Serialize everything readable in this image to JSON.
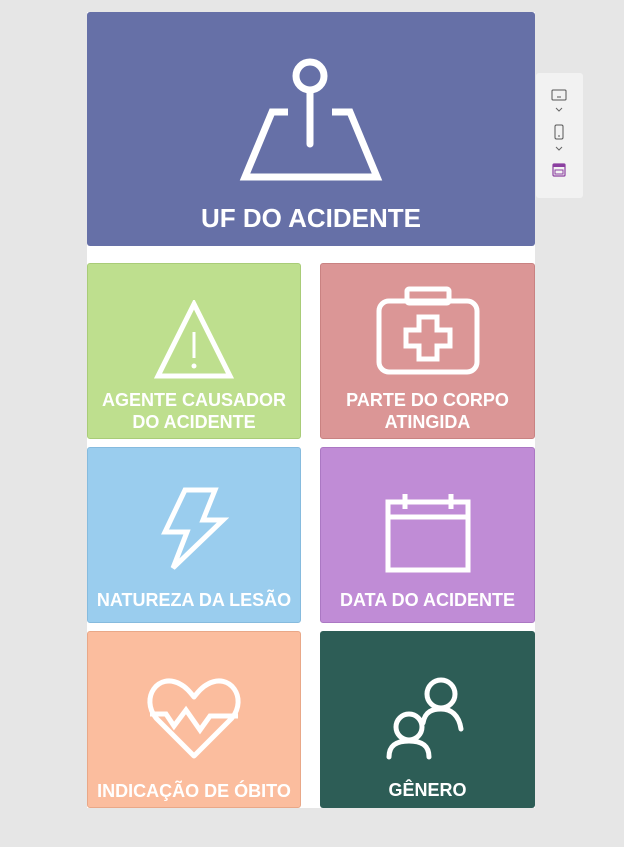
{
  "tiles": {
    "uf": {
      "label": "UF DO ACIDENTE",
      "icon": "map-pin-icon",
      "color": "#6670a7"
    },
    "agente": {
      "label": "AGENTE CAUSADOR\nDO ACIDENTE",
      "icon": "warning-icon",
      "color": "#bedf8e"
    },
    "parte": {
      "label": "PARTE DO CORPO\nATINGIDA",
      "icon": "first-aid-kit-icon",
      "color": "#db9696"
    },
    "natureza": {
      "label": "NATUREZA DA LESÃO",
      "icon": "lightning-icon",
      "color": "#9acdee"
    },
    "data": {
      "label": "DATA DO ACIDENTE",
      "icon": "calendar-icon",
      "color": "#c08cd6"
    },
    "obito": {
      "label": "INDICAÇÃO DE ÓBITO",
      "icon": "heartbeat-icon",
      "color": "#fbbd9e"
    },
    "genero": {
      "label": "GÊNERO",
      "icon": "people-icon",
      "color": "#2d5d56"
    }
  },
  "side_pane": {
    "items": [
      "desktop-view-icon",
      "phone-view-icon",
      "page-view-icon"
    ],
    "accent": "#8b3fa0"
  }
}
